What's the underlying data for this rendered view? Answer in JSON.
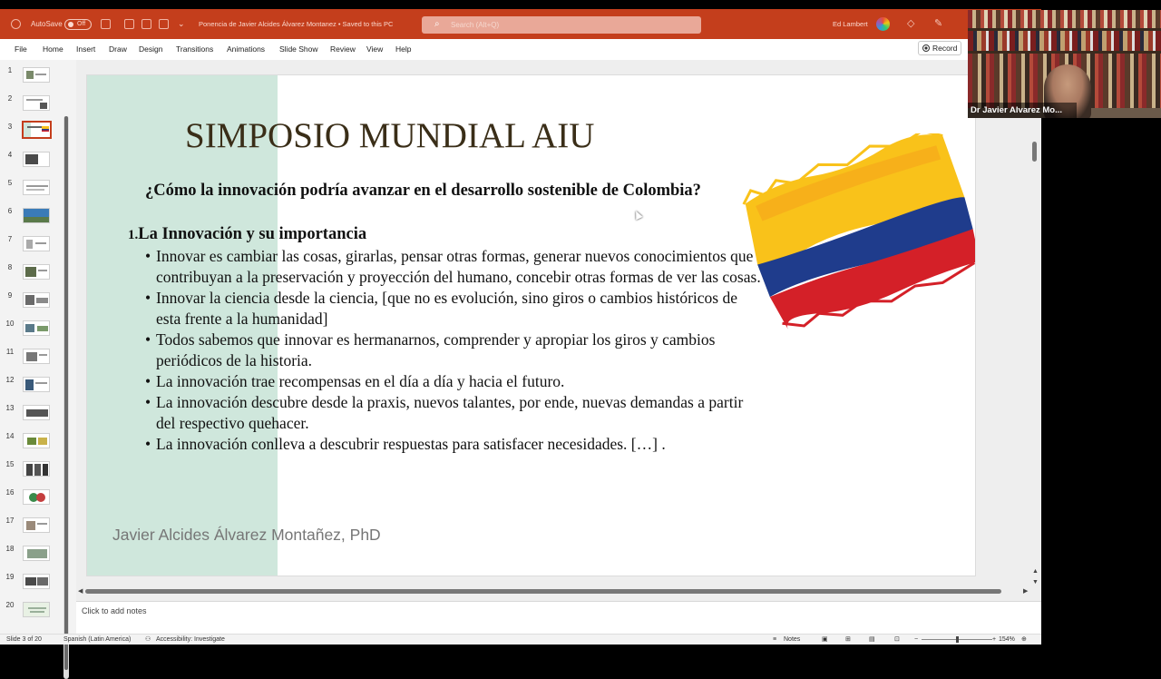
{
  "titlebar": {
    "autosave_label": "AutoSave",
    "autosave_state": "Off",
    "document_title": "Ponencia de Javier Alcides Álvarez Montanez • Saved to this PC",
    "search_placeholder": "Search (Alt+Q)",
    "user_name": "Ed Lambert",
    "bg_color": "#c43e1c"
  },
  "menubar": {
    "items": [
      "File",
      "Home",
      "Insert",
      "Draw",
      "Design",
      "Transitions",
      "Animations",
      "Slide Show",
      "Review",
      "View",
      "Help"
    ],
    "record_label": "Record"
  },
  "thumbnails": {
    "numbers": [
      "1",
      "2",
      "3",
      "4",
      "5",
      "6",
      "7",
      "8",
      "9",
      "10",
      "11",
      "12",
      "13",
      "14",
      "15",
      "16",
      "17",
      "18",
      "19",
      "20"
    ],
    "selected": 3
  },
  "slide": {
    "title": "SIMPOSIO MUNDIAL AIU",
    "question": "¿Cómo la innovación podría avanzar en el desarrollo sostenible de Colombia?",
    "section_number": "1.",
    "section_heading": "La Innovación  y su importancia",
    "bullets": [
      "Innovar es cambiar las cosas, girarlas, pensar otras formas, generar nuevos conocimientos que contribuyan a la preservación y proyección del humano, concebir otras formas de ver las cosas.",
      "Innovar la ciencia desde la ciencia,  [que no es evolución, sino giros o cambios históricos de esta frente a la humanidad]",
      "Todos sabemos que innovar es hermanarnos, comprender y apropiar los giros y cambios periódicos de la historia.",
      "La innovación trae recompensas en el día a día y hacia el futuro.",
      "La innovación descubre desde la praxis, nuevos talantes, por ende, nuevas demandas a partir del respectivo quehacer.",
      "La innovación conlleva  a descubrir respuestas para satisfacer necesidades. […] ."
    ],
    "author": "Javier Alcides Álvarez Montañez, PhD",
    "flag_colors": [
      "#f9c21a",
      "#1f3c8c",
      "#d42028"
    ],
    "band_color": "#cfe7dc"
  },
  "notes": {
    "placeholder": "Click to add notes"
  },
  "statusbar": {
    "slide_indicator": "Slide 3 of 20",
    "language": "Spanish (Latin America)",
    "accessibility": "Accessibility: Investigate",
    "notes_label": "Notes",
    "zoom": "154%"
  },
  "webcam": {
    "participant_name": "Dr Javier Alvarez Mo..."
  }
}
